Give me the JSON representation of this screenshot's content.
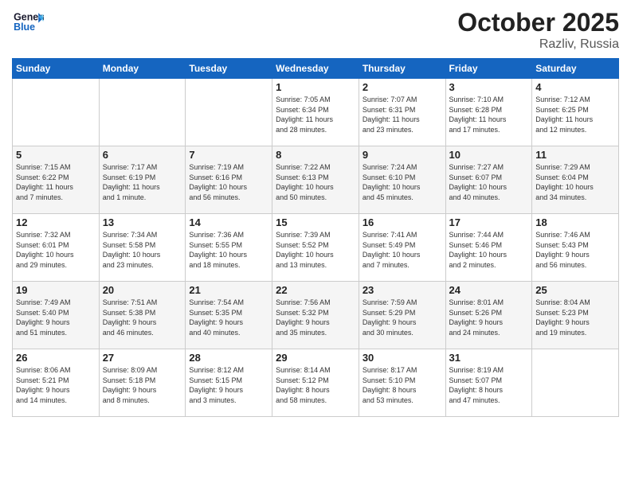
{
  "header": {
    "logo_line1": "General",
    "logo_line2": "Blue",
    "month": "October 2025",
    "location": "Razliv, Russia"
  },
  "weekdays": [
    "Sunday",
    "Monday",
    "Tuesday",
    "Wednesday",
    "Thursday",
    "Friday",
    "Saturday"
  ],
  "weeks": [
    [
      {
        "day": "",
        "info": ""
      },
      {
        "day": "",
        "info": ""
      },
      {
        "day": "",
        "info": ""
      },
      {
        "day": "1",
        "info": "Sunrise: 7:05 AM\nSunset: 6:34 PM\nDaylight: 11 hours\nand 28 minutes."
      },
      {
        "day": "2",
        "info": "Sunrise: 7:07 AM\nSunset: 6:31 PM\nDaylight: 11 hours\nand 23 minutes."
      },
      {
        "day": "3",
        "info": "Sunrise: 7:10 AM\nSunset: 6:28 PM\nDaylight: 11 hours\nand 17 minutes."
      },
      {
        "day": "4",
        "info": "Sunrise: 7:12 AM\nSunset: 6:25 PM\nDaylight: 11 hours\nand 12 minutes."
      }
    ],
    [
      {
        "day": "5",
        "info": "Sunrise: 7:15 AM\nSunset: 6:22 PM\nDaylight: 11 hours\nand 7 minutes."
      },
      {
        "day": "6",
        "info": "Sunrise: 7:17 AM\nSunset: 6:19 PM\nDaylight: 11 hours\nand 1 minute."
      },
      {
        "day": "7",
        "info": "Sunrise: 7:19 AM\nSunset: 6:16 PM\nDaylight: 10 hours\nand 56 minutes."
      },
      {
        "day": "8",
        "info": "Sunrise: 7:22 AM\nSunset: 6:13 PM\nDaylight: 10 hours\nand 50 minutes."
      },
      {
        "day": "9",
        "info": "Sunrise: 7:24 AM\nSunset: 6:10 PM\nDaylight: 10 hours\nand 45 minutes."
      },
      {
        "day": "10",
        "info": "Sunrise: 7:27 AM\nSunset: 6:07 PM\nDaylight: 10 hours\nand 40 minutes."
      },
      {
        "day": "11",
        "info": "Sunrise: 7:29 AM\nSunset: 6:04 PM\nDaylight: 10 hours\nand 34 minutes."
      }
    ],
    [
      {
        "day": "12",
        "info": "Sunrise: 7:32 AM\nSunset: 6:01 PM\nDaylight: 10 hours\nand 29 minutes."
      },
      {
        "day": "13",
        "info": "Sunrise: 7:34 AM\nSunset: 5:58 PM\nDaylight: 10 hours\nand 23 minutes."
      },
      {
        "day": "14",
        "info": "Sunrise: 7:36 AM\nSunset: 5:55 PM\nDaylight: 10 hours\nand 18 minutes."
      },
      {
        "day": "15",
        "info": "Sunrise: 7:39 AM\nSunset: 5:52 PM\nDaylight: 10 hours\nand 13 minutes."
      },
      {
        "day": "16",
        "info": "Sunrise: 7:41 AM\nSunset: 5:49 PM\nDaylight: 10 hours\nand 7 minutes."
      },
      {
        "day": "17",
        "info": "Sunrise: 7:44 AM\nSunset: 5:46 PM\nDaylight: 10 hours\nand 2 minutes."
      },
      {
        "day": "18",
        "info": "Sunrise: 7:46 AM\nSunset: 5:43 PM\nDaylight: 9 hours\nand 56 minutes."
      }
    ],
    [
      {
        "day": "19",
        "info": "Sunrise: 7:49 AM\nSunset: 5:40 PM\nDaylight: 9 hours\nand 51 minutes."
      },
      {
        "day": "20",
        "info": "Sunrise: 7:51 AM\nSunset: 5:38 PM\nDaylight: 9 hours\nand 46 minutes."
      },
      {
        "day": "21",
        "info": "Sunrise: 7:54 AM\nSunset: 5:35 PM\nDaylight: 9 hours\nand 40 minutes."
      },
      {
        "day": "22",
        "info": "Sunrise: 7:56 AM\nSunset: 5:32 PM\nDaylight: 9 hours\nand 35 minutes."
      },
      {
        "day": "23",
        "info": "Sunrise: 7:59 AM\nSunset: 5:29 PM\nDaylight: 9 hours\nand 30 minutes."
      },
      {
        "day": "24",
        "info": "Sunrise: 8:01 AM\nSunset: 5:26 PM\nDaylight: 9 hours\nand 24 minutes."
      },
      {
        "day": "25",
        "info": "Sunrise: 8:04 AM\nSunset: 5:23 PM\nDaylight: 9 hours\nand 19 minutes."
      }
    ],
    [
      {
        "day": "26",
        "info": "Sunrise: 8:06 AM\nSunset: 5:21 PM\nDaylight: 9 hours\nand 14 minutes."
      },
      {
        "day": "27",
        "info": "Sunrise: 8:09 AM\nSunset: 5:18 PM\nDaylight: 9 hours\nand 8 minutes."
      },
      {
        "day": "28",
        "info": "Sunrise: 8:12 AM\nSunset: 5:15 PM\nDaylight: 9 hours\nand 3 minutes."
      },
      {
        "day": "29",
        "info": "Sunrise: 8:14 AM\nSunset: 5:12 PM\nDaylight: 8 hours\nand 58 minutes."
      },
      {
        "day": "30",
        "info": "Sunrise: 8:17 AM\nSunset: 5:10 PM\nDaylight: 8 hours\nand 53 minutes."
      },
      {
        "day": "31",
        "info": "Sunrise: 8:19 AM\nSunset: 5:07 PM\nDaylight: 8 hours\nand 47 minutes."
      },
      {
        "day": "",
        "info": ""
      }
    ]
  ]
}
